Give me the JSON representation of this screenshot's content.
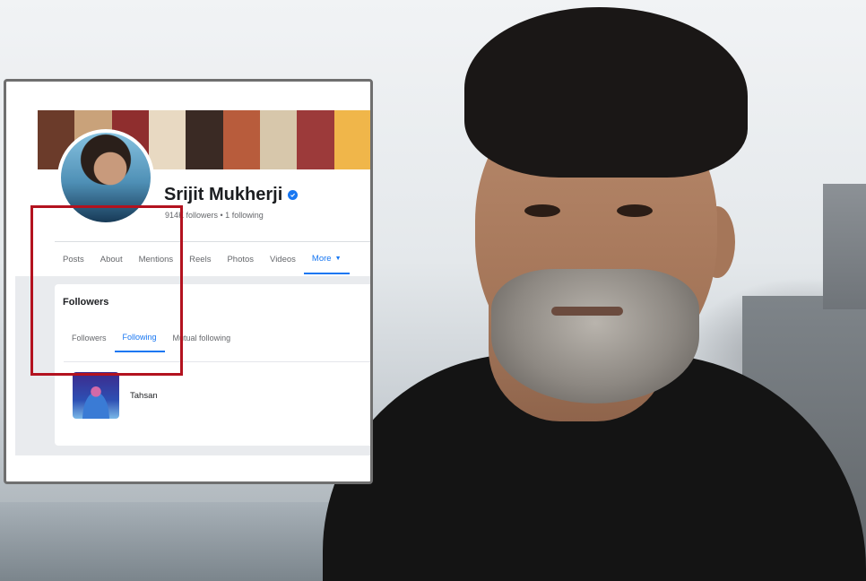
{
  "profile": {
    "name": "Srijit Mukherji",
    "stats": "914K followers • 1 following",
    "cover_tiles": [
      "#6b3b2a",
      "#c9a27a",
      "#8f2e2e",
      "#e8d9c2",
      "#3a2a24",
      "#b85c3c",
      "#d7c7ab",
      "#9c3a3a",
      "#f0b64a"
    ]
  },
  "nav": {
    "tabs": [
      {
        "label": "Posts",
        "key": "posts"
      },
      {
        "label": "About",
        "key": "about"
      },
      {
        "label": "Mentions",
        "key": "mentions"
      },
      {
        "label": "Reels",
        "key": "reels"
      },
      {
        "label": "Photos",
        "key": "photos"
      },
      {
        "label": "Videos",
        "key": "videos"
      },
      {
        "label": "More",
        "key": "more"
      }
    ]
  },
  "followers_panel": {
    "title": "Followers",
    "sub_tabs": [
      {
        "label": "Followers",
        "key": "followers"
      },
      {
        "label": "Following",
        "key": "following"
      },
      {
        "label": "Mutual following",
        "key": "mutual"
      }
    ],
    "active_sub_tab": "following",
    "items": [
      {
        "name": "Tahsan"
      }
    ]
  },
  "colors": {
    "accent": "#1877f2",
    "highlight": "#b3121f"
  }
}
